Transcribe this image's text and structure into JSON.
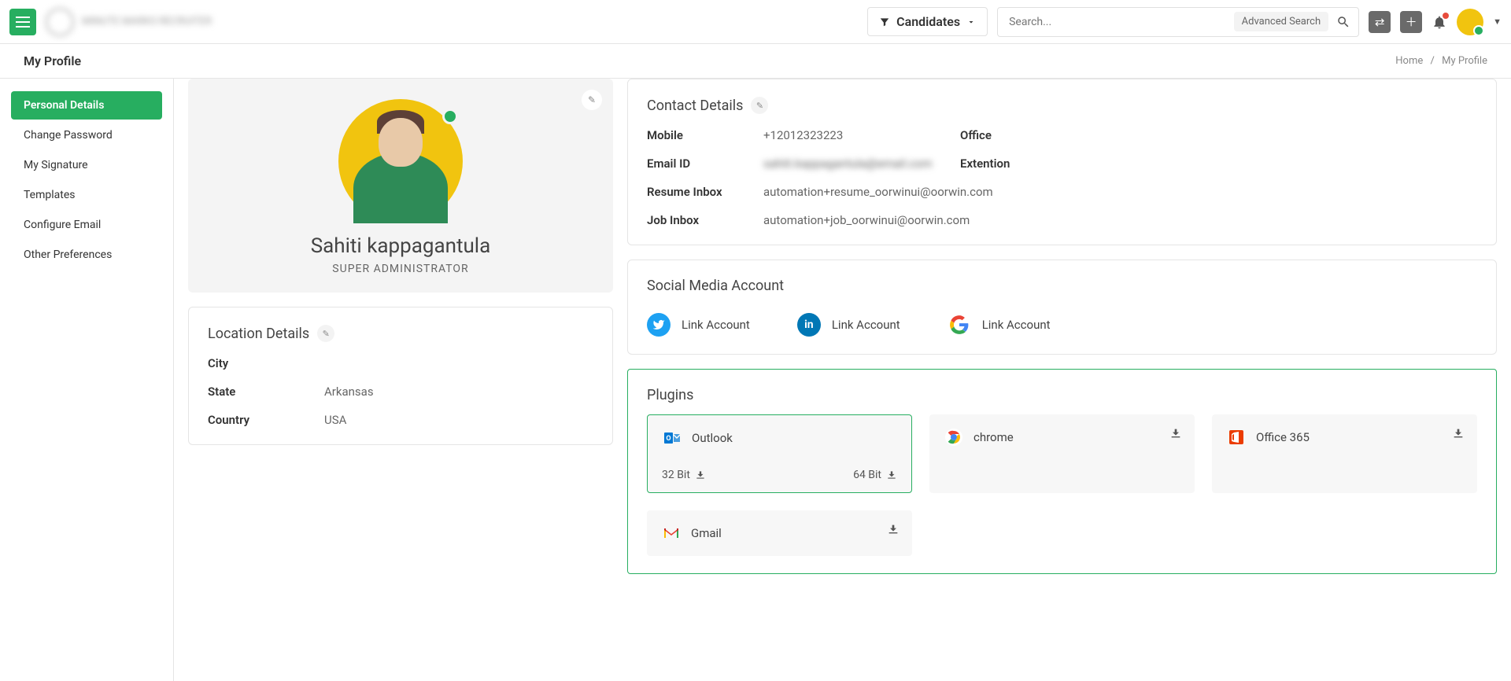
{
  "topbar": {
    "logo_text": "MINUTE MARKS\nRECRUITER",
    "candidates_label": "Candidates",
    "search_placeholder": "Search...",
    "advanced_search": "Advanced Search"
  },
  "subbar": {
    "title": "My Profile",
    "breadcrumb": {
      "home": "Home",
      "separator": "/",
      "current": "My Profile"
    }
  },
  "sidebar": {
    "items": [
      {
        "label": "Personal Details",
        "active": true
      },
      {
        "label": "Change Password"
      },
      {
        "label": "My Signature"
      },
      {
        "label": "Templates"
      },
      {
        "label": "Configure Email"
      },
      {
        "label": "Other Preferences"
      }
    ]
  },
  "profile": {
    "name": "Sahiti kappagantula",
    "role": "SUPER ADMINISTRATOR"
  },
  "location": {
    "title": "Location Details",
    "city_label": "City",
    "city_value": "",
    "state_label": "State",
    "state_value": "Arkansas",
    "country_label": "Country",
    "country_value": "USA"
  },
  "contact": {
    "title": "Contact Details",
    "mobile_label": "Mobile",
    "mobile_value": "+12012323223",
    "office_label": "Office",
    "email_label": "Email ID",
    "email_value": "sahiti.kappagantula@email.com",
    "ext_label": "Extention",
    "resume_label": "Resume Inbox",
    "resume_value": "automation+resume_oorwinui@oorwin.com",
    "job_label": "Job Inbox",
    "job_value": "automation+job_oorwinui@oorwin.com"
  },
  "social": {
    "title": "Social Media Account",
    "link_label": "Link Account"
  },
  "plugins": {
    "title": "Plugins",
    "outlook": "Outlook",
    "bit32": "32 Bit",
    "bit64": "64 Bit",
    "chrome": "chrome",
    "office365": "Office 365",
    "gmail": "Gmail"
  }
}
